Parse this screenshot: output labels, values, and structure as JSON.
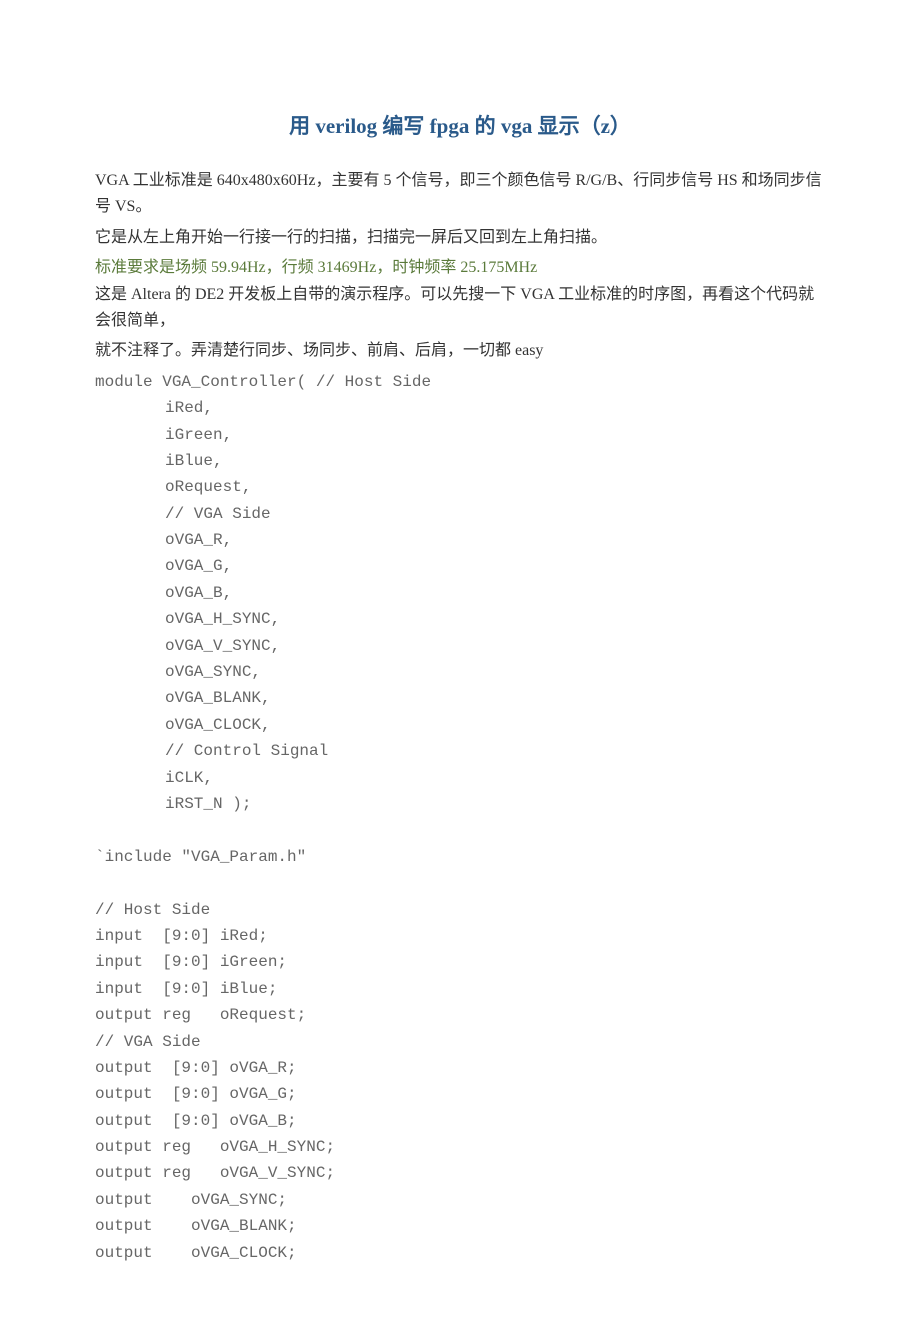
{
  "title": "用 verilog 编写 fpga 的 vga 显示（z）",
  "intro": {
    "line1": "VGA 工业标准是 640x480x60Hz，主要有 5 个信号，即三个颜色信号 R/G/B、行同步信号 HS 和场同步信号 VS。",
    "line2": "它是从左上角开始一行接一行的扫描，扫描完一屏后又回到左上角扫描。",
    "line3": "标准要求是场频 59.94Hz，行频 31469Hz，时钟频率 25.175MHz",
    "line4": "这是 Altera 的 DE2 开发板上自带的演示程序。可以先搜一下 VGA 工业标准的时序图，再看这个代码就会很简单，",
    "line5": "就不注释了。弄清楚行同步、场同步、前肩、后肩，一切都 easy"
  },
  "code": {
    "module_line": "module VGA_Controller( // Host Side",
    "params": [
      "iRed,",
      "iGreen,",
      "iBlue,",
      "oRequest,",
      "// VGA Side",
      "oVGA_R,",
      "oVGA_G,",
      "oVGA_B,",
      "oVGA_H_SYNC,",
      "oVGA_V_SYNC,",
      "oVGA_SYNC,",
      "oVGA_BLANK,",
      "oVGA_CLOCK,",
      "// Control Signal",
      "iCLK,",
      "iRST_N );"
    ],
    "include": "`include \"VGA_Param.h\"",
    "decls": [
      "// Host Side",
      "input  [9:0] iRed;",
      "input  [9:0] iGreen;",
      "input  [9:0] iBlue;",
      "output reg   oRequest;",
      "// VGA Side",
      "output  [9:0] oVGA_R;",
      "output  [9:0] oVGA_G;",
      "output  [9:0] oVGA_B;",
      "output reg   oVGA_H_SYNC;",
      "output reg   oVGA_V_SYNC;",
      "output    oVGA_SYNC;",
      "output    oVGA_BLANK;",
      "output    oVGA_CLOCK;"
    ]
  }
}
